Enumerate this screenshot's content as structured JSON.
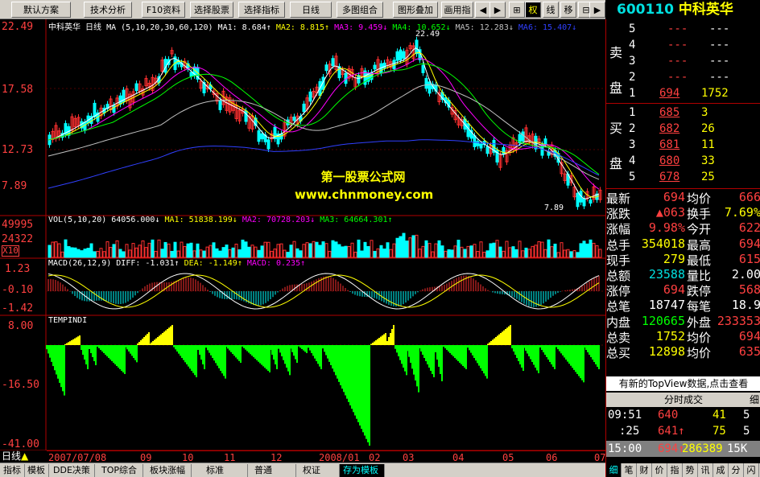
{
  "toolbar": {
    "buttons": [
      "默认方案",
      "技术分析",
      "F10资料",
      "选择股票",
      "选择指标",
      "日线",
      "多图组合",
      "图形叠加",
      "画用指"
    ],
    "icons": [
      "◀",
      "▶",
      "⊞",
      "权",
      "线",
      "移",
      "⊟",
      "▶"
    ]
  },
  "stock": {
    "code": "600110",
    "name": "中科英华"
  },
  "chart": {
    "title": "中科英华 日线",
    "ma_legend": "MA (5,10,20,30,60,120)",
    "ma1": "MA1: 8.684↑",
    "ma2": "MA2: 8.815↑",
    "ma3": "MA3: 9.459↓",
    "ma4": "MA4: 10.652↓",
    "ma5": "MA5: 12.283↓",
    "ma6": "MA6: 15.407↓",
    "price_ticks": [
      "22.49",
      "17.58",
      "12.73",
      "7.89"
    ],
    "annot_high": "22.49",
    "annot_low": "7.89",
    "watermark_line1": "第一股票公式网",
    "watermark_line2": "www.chnmoney.com"
  },
  "vol": {
    "legend": "VOL(5,10,20) 64056.000↓",
    "ma1": "MA1: 51838.199↓",
    "ma2": "MA2: 70728.203↓",
    "ma3": "MA3: 64664.301↑",
    "ticks": [
      "49995",
      "24322"
    ],
    "unit": "X10"
  },
  "macd": {
    "legend": "MACD(26,12,9) DIFF: -1.031↑",
    "dea": "DEA: -1.149↑",
    "macd": "MACD: 0.235↑",
    "ticks": [
      "1.23",
      "-0.10",
      "-1.42"
    ]
  },
  "temp": {
    "legend": "TEMPINDI",
    "ticks": [
      "8.00",
      "-16.50",
      "-41.00"
    ]
  },
  "xaxis": [
    "2007/07/08",
    "09",
    "10",
    "11",
    "12",
    "2008/01",
    "02",
    "03",
    "04",
    "05",
    "06",
    "07"
  ],
  "left_label": "日线",
  "bottom_tabs": [
    "指标",
    "模板",
    "DDE决策",
    "TOP综合",
    "板块涨幅",
    "标准",
    "普通",
    "权证",
    "存为模板"
  ],
  "orderbook": {
    "sell_label": "卖盘",
    "buy_label": "买盘",
    "sells": [
      {
        "lv": "5",
        "p": "---",
        "v": "---"
      },
      {
        "lv": "4",
        "p": "---",
        "v": "---"
      },
      {
        "lv": "3",
        "p": "---",
        "v": "---"
      },
      {
        "lv": "2",
        "p": "---",
        "v": "---"
      },
      {
        "lv": "1",
        "p": "694",
        "v": "1752"
      }
    ],
    "buys": [
      {
        "lv": "1",
        "p": "685",
        "v": "3"
      },
      {
        "lv": "2",
        "p": "682",
        "v": "26"
      },
      {
        "lv": "3",
        "p": "681",
        "v": "11"
      },
      {
        "lv": "4",
        "p": "680",
        "v": "33"
      },
      {
        "lv": "5",
        "p": "678",
        "v": "25"
      }
    ]
  },
  "quote": [
    {
      "k1": "最新",
      "v1": "694",
      "k2": "均价",
      "v2": "666"
    },
    {
      "k1": "涨跌",
      "v1": "▲063",
      "k2": "换手",
      "v2": "7.69%"
    },
    {
      "k1": "涨幅",
      "v1": "9.98%",
      "k2": "今开",
      "v2": "622"
    },
    {
      "k1": "总手",
      "v1": "354018",
      "k2": "最高",
      "v2": "694"
    },
    {
      "k1": "现手",
      "v1": "279",
      "k2": "最低",
      "v2": "615"
    },
    {
      "k1": "总额",
      "v1": "23588",
      "k2": "量比",
      "v2": "2.00"
    },
    {
      "k1": "涨停",
      "v1": "694",
      "k2": "跌停",
      "v2": "568"
    },
    {
      "k1": "总笔",
      "v1": "18747",
      "k2": "每笔",
      "v2": "18.9"
    },
    {
      "k1": "内盘",
      "v1": "120665",
      "k2": "外盘",
      "v2": "233353"
    },
    {
      "k1": "总卖",
      "v1": "1752",
      "k2": "均价",
      "v2": "694"
    },
    {
      "k1": "总买",
      "v1": "12898",
      "k2": "均价",
      "v2": "635"
    }
  ],
  "topview": "有新的TopView数据,点击查看",
  "ticks_title": "分时成交",
  "ticks_more": "细",
  "trades": [
    {
      "t": "09:51",
      "p": "640",
      "v": "41",
      "n": "5"
    },
    {
      "t": ":25",
      "p": "641↑",
      "v": "75",
      "n": "5"
    }
  ],
  "last_trade": {
    "t": "15:00",
    "p": "694↑",
    "v": "286389",
    "n": "15K"
  },
  "right_tabs": [
    "细",
    "笔",
    "财",
    "价",
    "指",
    "势",
    "讯",
    "成",
    "分",
    "闪"
  ]
}
